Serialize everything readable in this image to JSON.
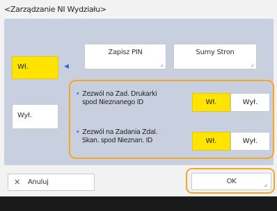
{
  "title": "<Zarządzanie NI Wydziału>",
  "side": {
    "on_label": "Wł.",
    "off_label": "Wył."
  },
  "top_buttons": {
    "pin_label": "Zapisz PIN",
    "sums_label": "Sumy Stron"
  },
  "rows": [
    {
      "line1": "Zezwól na Zad. Drukarki",
      "line2": "spod Nieznanego ID",
      "on_label": "Wł.",
      "off_label": "Wył."
    },
    {
      "line1": "Zezwól na Zadania Zdal.",
      "line2": "Skan. spod Nieznan. ID",
      "on_label": "Wł.",
      "off_label": "Wył."
    }
  ],
  "footer_buttons": {
    "cancel_label": "Anuluj",
    "ok_label": "OK"
  },
  "colors": {
    "accent_yellow": "#ffe400",
    "highlight_orange": "#f5a623",
    "panel_blue": "#c8d0df",
    "arrow_blue": "#2b6fd6"
  },
  "icons": {
    "cancel": "close-icon",
    "arrow": "left-pointer-icon",
    "corner": "corner-marker-icon"
  }
}
